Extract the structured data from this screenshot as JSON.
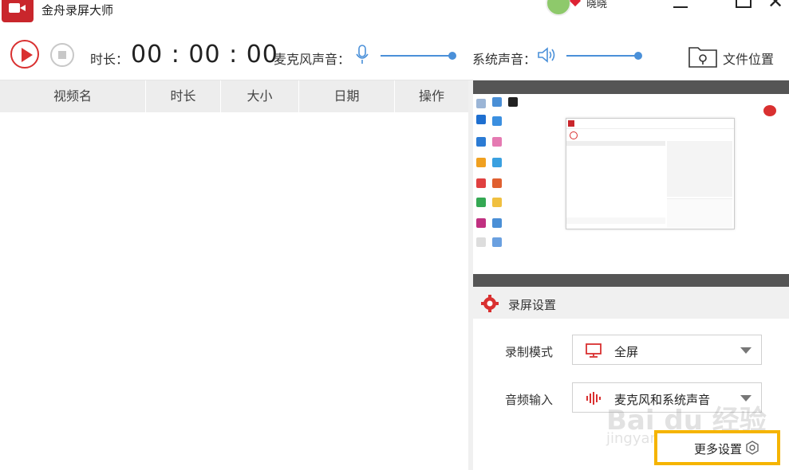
{
  "app": {
    "title": "金舟录屏大师",
    "user_name": "晓晓"
  },
  "toolbar": {
    "duration_label": "时长：",
    "duration_value": "00 : 00 : 00",
    "mic_label": "麦克风声音：",
    "system_label": "系统声音：",
    "folder_label": "文件位置",
    "mic_volume": 0.95,
    "system_volume": 0.95
  },
  "table": {
    "columns": [
      "视频名",
      "时长",
      "大小",
      "日期",
      "操作"
    ]
  },
  "settings": {
    "title": "录屏设置",
    "mode_label": "录制模式",
    "mode_value": "全屏",
    "audio_label": "音频输入",
    "audio_value": "麦克风和系统声音",
    "more_label": "更多设置"
  },
  "watermark": {
    "text": "Bai du 经验",
    "sub": "jingyan.baidu.com"
  },
  "colors": {
    "accent_red": "#d93030",
    "slider_blue": "#4a90d9",
    "highlight": "#f5b400"
  }
}
